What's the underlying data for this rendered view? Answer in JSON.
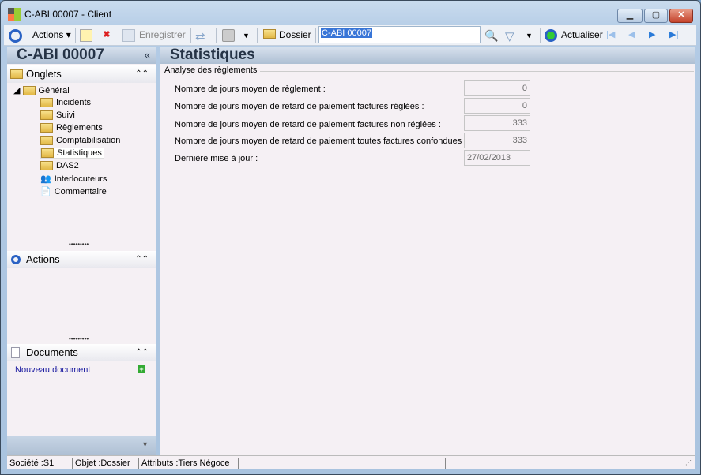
{
  "window": {
    "title": "C-ABI 00007 -  Client"
  },
  "toolbar": {
    "actions": "Actions",
    "save": "Enregistrer",
    "dossier": "Dossier",
    "search_value": "C-ABI 00007",
    "refresh": "Actualiser"
  },
  "left": {
    "title": "C-ABI 00007",
    "onglets": "Onglets",
    "actions": "Actions",
    "documents": "Documents",
    "new_document": "Nouveau document",
    "tree": {
      "root": "Général",
      "items": [
        "Incidents",
        "Suivi",
        "Règlements",
        "Comptabilisation",
        "Statistiques",
        "DAS2",
        "Interlocuteurs",
        "Commentaire"
      ],
      "selected": "Statistiques"
    }
  },
  "main": {
    "title": "Statistiques",
    "group": "Analyse des règlements",
    "rows": [
      {
        "label": "Nombre de jours moyen de règlement :",
        "value": "0"
      },
      {
        "label": "Nombre de jours moyen de retard de paiement factures réglées :",
        "value": "0"
      },
      {
        "label": "Nombre de jours moyen de retard de paiement factures non réglées :",
        "value": "333"
      },
      {
        "label": "Nombre de jours moyen de retard de paiement toutes factures confondues :",
        "value": "333"
      },
      {
        "label": "Dernière mise à jour :",
        "value": "27/02/2013"
      }
    ]
  },
  "status": {
    "societe": "Société :S1",
    "objet": "Objet :Dossier",
    "attributs": "Attributs :Tiers Négoce"
  }
}
